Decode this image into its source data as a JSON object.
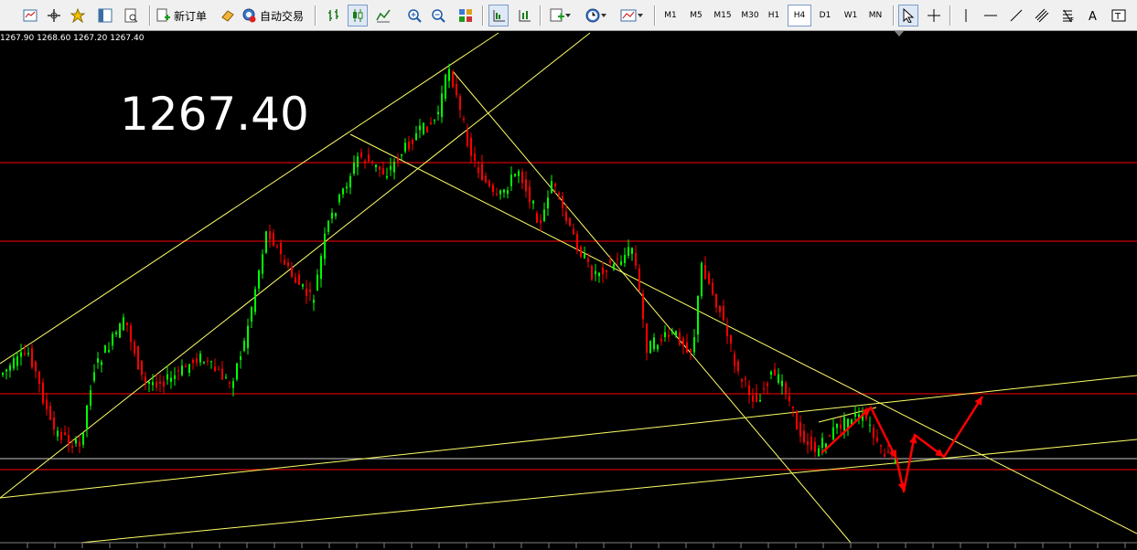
{
  "toolbar": {
    "new_order_label": "新订单",
    "auto_trading_label": "自动交易",
    "timeframes": [
      "M1",
      "M5",
      "M15",
      "M30",
      "H1",
      "H4",
      "D1",
      "W1",
      "MN"
    ],
    "active_timeframe": "H4"
  },
  "ohlc_readout": "1267.90 1268.60 1267.20 1267.40",
  "big_price": "1267.40",
  "colors": {
    "bull_candle": "#00ff00",
    "bear_candle": "#ff0000",
    "trendline": "#ffff66",
    "horizontal_level": "#ff0000",
    "projection_arrow": "#ff0000",
    "background": "#000000"
  }
}
